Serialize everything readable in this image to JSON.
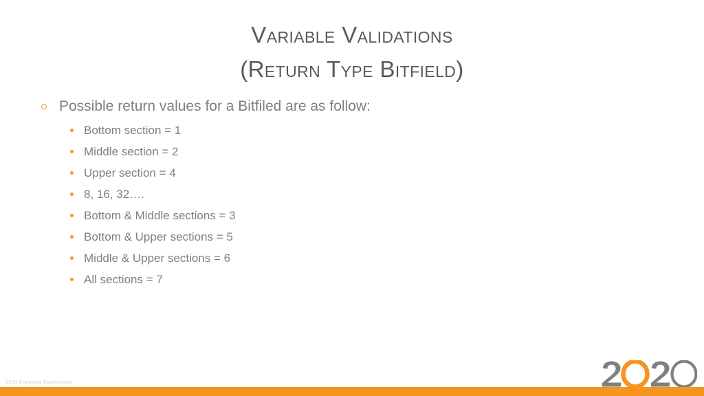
{
  "slide": {
    "title_line_1": "Variable Validations",
    "title_line_2": "(Return Type Bitfield)",
    "title_color": "#595959",
    "background_color": "#ffffff"
  },
  "content": {
    "level1_bullet": {
      "text": "Possible return values for a Bitfiled are as follow:",
      "marker": "hollow-circle-bullet-icon",
      "marker_color": "#eda01f"
    },
    "level2_bullets": [
      {
        "text": "Bottom section = 1"
      },
      {
        "text": "Middle section = 2"
      },
      {
        "text": "Upper section = 4"
      },
      {
        "text": "8, 16, 32…."
      },
      {
        "text": "Bottom & Middle sections = 3"
      },
      {
        "text": "Bottom & Upper sections = 5"
      },
      {
        "text": "Middle & Upper sections = 6"
      },
      {
        "text": "All sections = 7"
      }
    ],
    "level2_marker": "filled-dot-bullet-icon",
    "level2_marker_color": "#eda01f",
    "body_text_color": "#7f7f7f"
  },
  "footer": {
    "confidentiality_note": "2020 Company Confidential",
    "note_color": "#d2d2d2",
    "logo": {
      "name": "2020-logo",
      "characters": [
        "2",
        "0",
        "2",
        "0"
      ],
      "gray_color": "#808080",
      "accent_color": "#f7941e"
    },
    "accent_bar_color": "#f7941e"
  }
}
